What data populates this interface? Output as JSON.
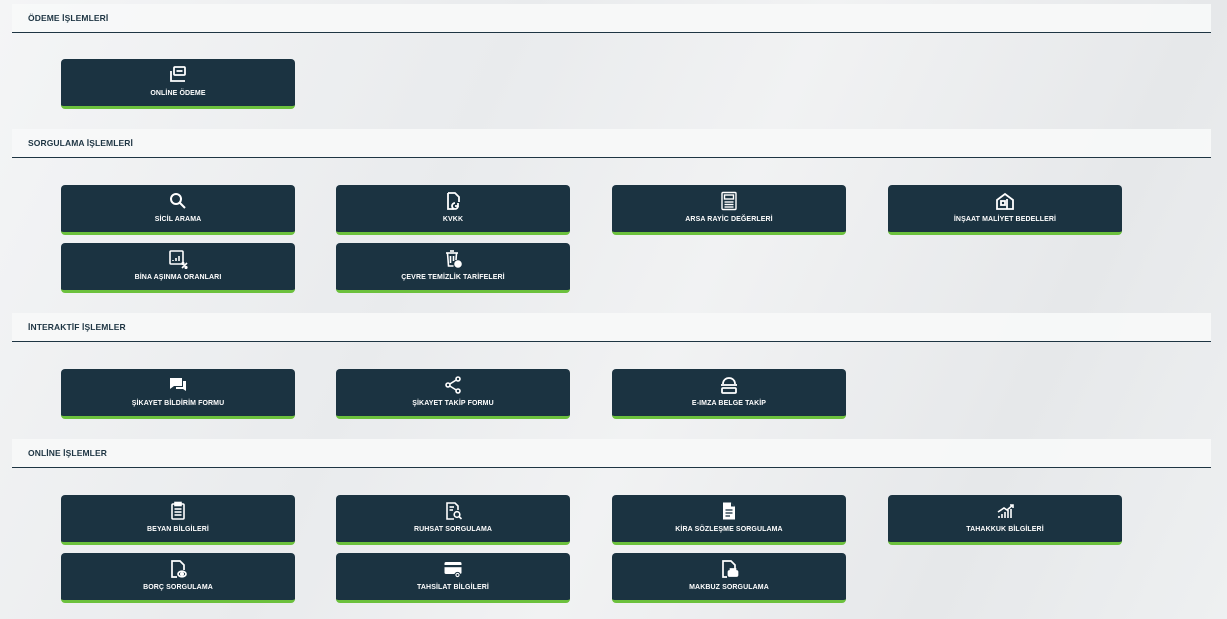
{
  "sections": [
    {
      "title": "ÖDEME İŞLEMLERİ",
      "tiles": [
        {
          "label": "ONLİNE ÖDEME",
          "icon": "laptop-icon"
        }
      ]
    },
    {
      "title": "SORGULAMA İŞLEMLERİ",
      "tiles": [
        {
          "label": "SİCİL ARAMA",
          "icon": "search-icon"
        },
        {
          "label": "KVKK",
          "icon": "document-refresh-icon"
        },
        {
          "label": "ARSA RAYİC DEĞERLERİ",
          "icon": "calculator-icon"
        },
        {
          "label": "İNŞAAT MALİYET BEDELLERİ",
          "icon": "building-icon"
        },
        {
          "label": "BİNA AŞINMA ORANLARI",
          "icon": "percent-chart-icon"
        },
        {
          "label": "ÇEVRE TEMİZLİK TARİFELERİ",
          "icon": "trash-icon"
        }
      ]
    },
    {
      "title": "İNTERAKTİF İŞLEMLER",
      "tiles": [
        {
          "label": "ŞİKAYET BİLDİRİM FORMU",
          "icon": "chat-icon"
        },
        {
          "label": "ŞİKAYET TAKİP FORMU",
          "icon": "share-icon"
        },
        {
          "label": "E-IMZA BELGE TAKİP",
          "icon": "stack-icon"
        }
      ]
    },
    {
      "title": "ONLİNE İŞLEMLER",
      "tiles": [
        {
          "label": "BEYAN BİLGİLERİ",
          "icon": "clipboard-icon"
        },
        {
          "label": "RUHSAT SORGULAMA",
          "icon": "document-search-icon"
        },
        {
          "label": "KİRA SÖZLEŞME SORGULAMA",
          "icon": "document-icon"
        },
        {
          "label": "TAHAKKUK BİLGİLERİ",
          "icon": "rising-chart-icon"
        },
        {
          "label": "BORÇ SORGULAMA",
          "icon": "document-eye-icon"
        },
        {
          "label": "TAHSİLAT BİLGİLERİ",
          "icon": "card-icon"
        },
        {
          "label": "MAKBUZ SORGULAMA",
          "icon": "document-print-icon"
        }
      ]
    }
  ],
  "colors": {
    "tile_bg": "#1b3341",
    "tile_accent": "#6cc13d",
    "heading": "#1e3543"
  }
}
